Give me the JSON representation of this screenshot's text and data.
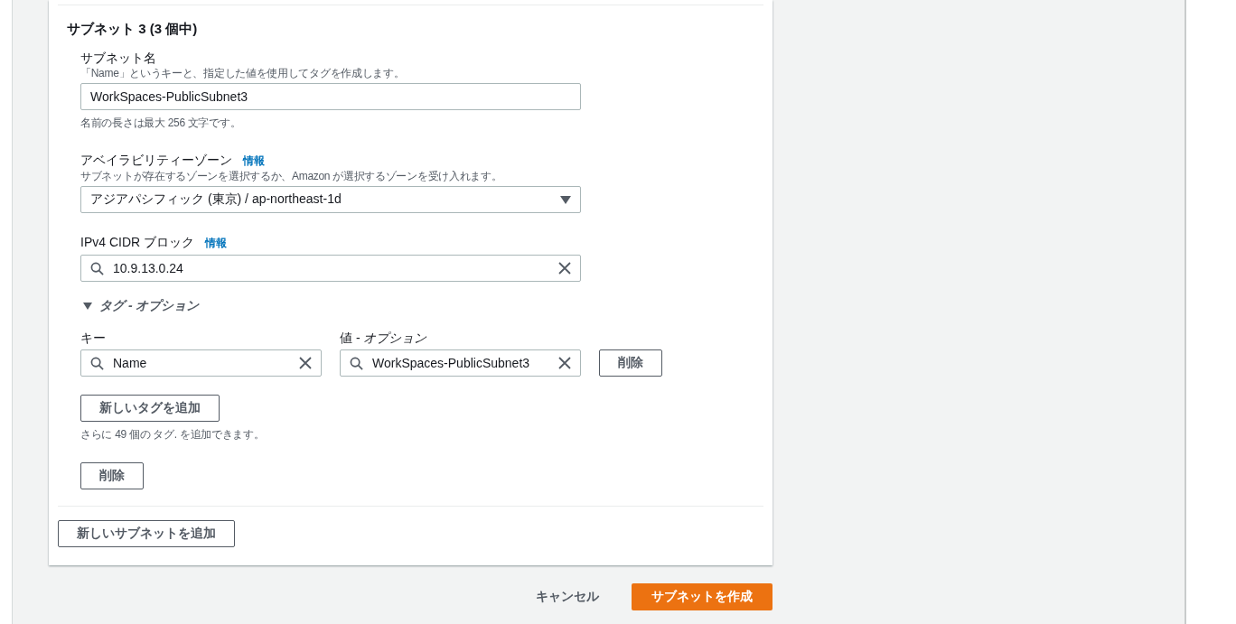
{
  "subnet": {
    "title": "サブネット 3 (3 個中)",
    "name_field": {
      "label": "サブネット名",
      "description": "「Name」というキーと、指定した値を使用してタグを作成します。",
      "value": "WorkSpaces-PublicSubnet3",
      "hint": "名前の長さは最大 256 文字です。"
    },
    "az_field": {
      "label": "アベイラビリティーゾーン",
      "info": "情報",
      "description": "サブネットが存在するゾーンを選択するか、Amazon が選択するゾーンを受け入れます。",
      "value": "アジアパシフィック (東京) / ap-northeast-1d"
    },
    "cidr_field": {
      "label": "IPv4 CIDR ブロック",
      "info": "情報",
      "value": "10.9.13.0.24"
    },
    "tags": {
      "heading": "タグ - オプション",
      "expanded": true,
      "key_label": "キー",
      "value_label": "値 - *オプション*",
      "rows": [
        {
          "key": "Name",
          "value": "WorkSpaces-PublicSubnet3",
          "remove": "削除"
        }
      ],
      "add_button": "新しいタグを追加",
      "hint": "さらに 49 個の タグ. を追加できます。"
    },
    "remove_button": "削除"
  },
  "add_subnet_button": "新しいサブネットを追加",
  "footer": {
    "cancel": "キャンセル",
    "create": "サブネットを作成"
  }
}
